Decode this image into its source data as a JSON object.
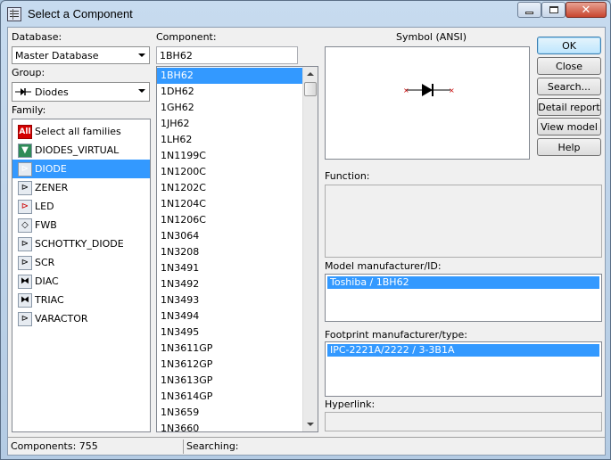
{
  "window": {
    "title": "Select a Component"
  },
  "database": {
    "label": "Database:",
    "value": "Master Database"
  },
  "group": {
    "label": "Group:",
    "value": "Diodes"
  },
  "family": {
    "label": "Family:",
    "items": [
      {
        "icon": "all-families-icon",
        "label": "Select all families"
      },
      {
        "icon": "diodes-virtual-icon",
        "label": "DIODES_VIRTUAL"
      },
      {
        "icon": "diode-icon",
        "label": "DIODE"
      },
      {
        "icon": "zener-icon",
        "label": "ZENER"
      },
      {
        "icon": "led-icon",
        "label": "LED"
      },
      {
        "icon": "fwb-icon",
        "label": "FWB"
      },
      {
        "icon": "schottky-diode-icon",
        "label": "SCHOTTKY_DIODE"
      },
      {
        "icon": "scr-icon",
        "label": "SCR"
      },
      {
        "icon": "diac-icon",
        "label": "DIAC"
      },
      {
        "icon": "triac-icon",
        "label": "TRIAC"
      },
      {
        "icon": "varactor-icon",
        "label": "VARACTOR"
      }
    ],
    "selected": "DIODE"
  },
  "component": {
    "label": "Component:",
    "search_value": "1BH62",
    "items": [
      "1BH62",
      "1DH62",
      "1GH62",
      "1JH62",
      "1LH62",
      "1N1199C",
      "1N1200C",
      "1N1202C",
      "1N1204C",
      "1N1206C",
      "1N3064",
      "1N3208",
      "1N3491",
      "1N3492",
      "1N3493",
      "1N3494",
      "1N3495",
      "1N3611GP",
      "1N3612GP",
      "1N3613GP",
      "1N3614GP",
      "1N3659",
      "1N3660"
    ],
    "selected": "1BH62"
  },
  "symbol": {
    "label": "Symbol (ANSI)"
  },
  "function": {
    "label": "Function:"
  },
  "model": {
    "label": "Model manufacturer/ID:",
    "value": "Toshiba / 1BH62"
  },
  "footprint": {
    "label": "Footprint manufacturer/type:",
    "value": "IPC-2221A/2222 / 3-3B1A"
  },
  "hyperlink": {
    "label": "Hyperlink:"
  },
  "buttons": {
    "ok": "OK",
    "close": "Close",
    "search": "Search...",
    "detail_report": "Detail report",
    "view_model": "View model",
    "help": "Help"
  },
  "status": {
    "components": "Components: 755",
    "searching": "Searching:"
  },
  "colors": {
    "selection": "#3399ff",
    "symbol_pin": "#cc0000"
  }
}
